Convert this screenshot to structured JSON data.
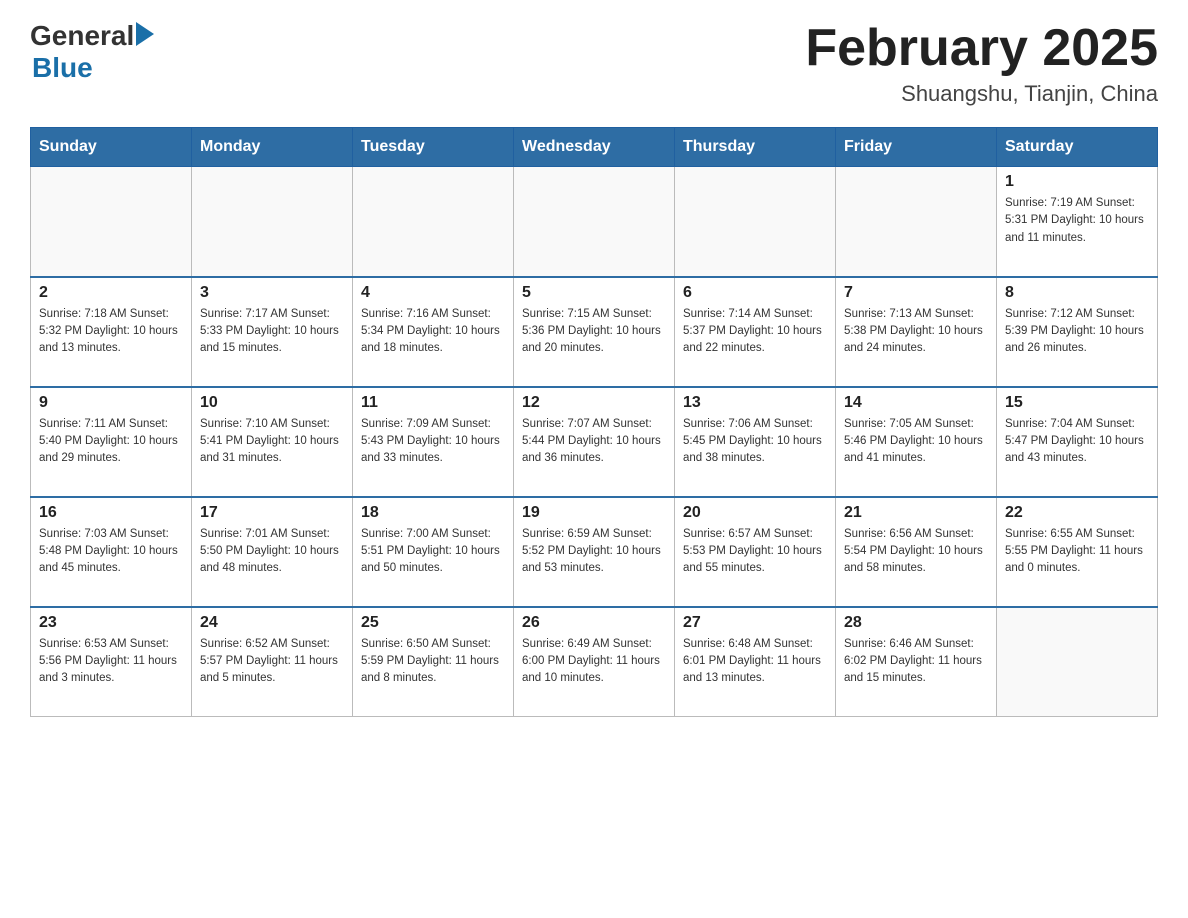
{
  "header": {
    "logo_general": "General",
    "logo_blue": "Blue",
    "title": "February 2025",
    "subtitle": "Shuangshu, Tianjin, China"
  },
  "days_of_week": [
    "Sunday",
    "Monday",
    "Tuesday",
    "Wednesday",
    "Thursday",
    "Friday",
    "Saturday"
  ],
  "weeks": [
    [
      {
        "day": "",
        "info": ""
      },
      {
        "day": "",
        "info": ""
      },
      {
        "day": "",
        "info": ""
      },
      {
        "day": "",
        "info": ""
      },
      {
        "day": "",
        "info": ""
      },
      {
        "day": "",
        "info": ""
      },
      {
        "day": "1",
        "info": "Sunrise: 7:19 AM\nSunset: 5:31 PM\nDaylight: 10 hours\nand 11 minutes."
      }
    ],
    [
      {
        "day": "2",
        "info": "Sunrise: 7:18 AM\nSunset: 5:32 PM\nDaylight: 10 hours\nand 13 minutes."
      },
      {
        "day": "3",
        "info": "Sunrise: 7:17 AM\nSunset: 5:33 PM\nDaylight: 10 hours\nand 15 minutes."
      },
      {
        "day": "4",
        "info": "Sunrise: 7:16 AM\nSunset: 5:34 PM\nDaylight: 10 hours\nand 18 minutes."
      },
      {
        "day": "5",
        "info": "Sunrise: 7:15 AM\nSunset: 5:36 PM\nDaylight: 10 hours\nand 20 minutes."
      },
      {
        "day": "6",
        "info": "Sunrise: 7:14 AM\nSunset: 5:37 PM\nDaylight: 10 hours\nand 22 minutes."
      },
      {
        "day": "7",
        "info": "Sunrise: 7:13 AM\nSunset: 5:38 PM\nDaylight: 10 hours\nand 24 minutes."
      },
      {
        "day": "8",
        "info": "Sunrise: 7:12 AM\nSunset: 5:39 PM\nDaylight: 10 hours\nand 26 minutes."
      }
    ],
    [
      {
        "day": "9",
        "info": "Sunrise: 7:11 AM\nSunset: 5:40 PM\nDaylight: 10 hours\nand 29 minutes."
      },
      {
        "day": "10",
        "info": "Sunrise: 7:10 AM\nSunset: 5:41 PM\nDaylight: 10 hours\nand 31 minutes."
      },
      {
        "day": "11",
        "info": "Sunrise: 7:09 AM\nSunset: 5:43 PM\nDaylight: 10 hours\nand 33 minutes."
      },
      {
        "day": "12",
        "info": "Sunrise: 7:07 AM\nSunset: 5:44 PM\nDaylight: 10 hours\nand 36 minutes."
      },
      {
        "day": "13",
        "info": "Sunrise: 7:06 AM\nSunset: 5:45 PM\nDaylight: 10 hours\nand 38 minutes."
      },
      {
        "day": "14",
        "info": "Sunrise: 7:05 AM\nSunset: 5:46 PM\nDaylight: 10 hours\nand 41 minutes."
      },
      {
        "day": "15",
        "info": "Sunrise: 7:04 AM\nSunset: 5:47 PM\nDaylight: 10 hours\nand 43 minutes."
      }
    ],
    [
      {
        "day": "16",
        "info": "Sunrise: 7:03 AM\nSunset: 5:48 PM\nDaylight: 10 hours\nand 45 minutes."
      },
      {
        "day": "17",
        "info": "Sunrise: 7:01 AM\nSunset: 5:50 PM\nDaylight: 10 hours\nand 48 minutes."
      },
      {
        "day": "18",
        "info": "Sunrise: 7:00 AM\nSunset: 5:51 PM\nDaylight: 10 hours\nand 50 minutes."
      },
      {
        "day": "19",
        "info": "Sunrise: 6:59 AM\nSunset: 5:52 PM\nDaylight: 10 hours\nand 53 minutes."
      },
      {
        "day": "20",
        "info": "Sunrise: 6:57 AM\nSunset: 5:53 PM\nDaylight: 10 hours\nand 55 minutes."
      },
      {
        "day": "21",
        "info": "Sunrise: 6:56 AM\nSunset: 5:54 PM\nDaylight: 10 hours\nand 58 minutes."
      },
      {
        "day": "22",
        "info": "Sunrise: 6:55 AM\nSunset: 5:55 PM\nDaylight: 11 hours\nand 0 minutes."
      }
    ],
    [
      {
        "day": "23",
        "info": "Sunrise: 6:53 AM\nSunset: 5:56 PM\nDaylight: 11 hours\nand 3 minutes."
      },
      {
        "day": "24",
        "info": "Sunrise: 6:52 AM\nSunset: 5:57 PM\nDaylight: 11 hours\nand 5 minutes."
      },
      {
        "day": "25",
        "info": "Sunrise: 6:50 AM\nSunset: 5:59 PM\nDaylight: 11 hours\nand 8 minutes."
      },
      {
        "day": "26",
        "info": "Sunrise: 6:49 AM\nSunset: 6:00 PM\nDaylight: 11 hours\nand 10 minutes."
      },
      {
        "day": "27",
        "info": "Sunrise: 6:48 AM\nSunset: 6:01 PM\nDaylight: 11 hours\nand 13 minutes."
      },
      {
        "day": "28",
        "info": "Sunrise: 6:46 AM\nSunset: 6:02 PM\nDaylight: 11 hours\nand 15 minutes."
      },
      {
        "day": "",
        "info": ""
      }
    ]
  ]
}
